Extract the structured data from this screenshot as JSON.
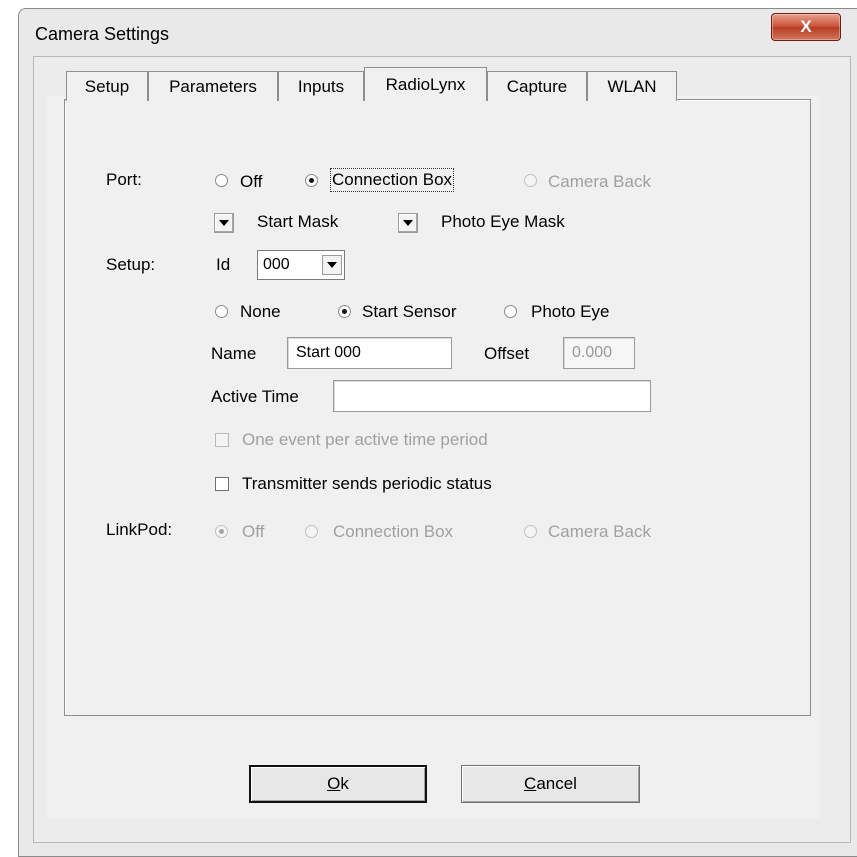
{
  "window": {
    "title": "Camera Settings",
    "close_label": "X"
  },
  "tabs": [
    "Setup",
    "Parameters",
    "Inputs",
    "RadioLynx",
    "Capture",
    "WLAN"
  ],
  "port": {
    "label": "Port:",
    "options": [
      "Off",
      "Connection Box",
      "Camera Back"
    ],
    "selected": "Connection Box"
  },
  "masks": {
    "start_mask": "Start Mask",
    "photo_eye_mask": "Photo Eye Mask"
  },
  "setup": {
    "label": "Setup:",
    "id_label": "Id",
    "id_value": "000",
    "sensor_options": [
      "None",
      "Start Sensor",
      "Photo Eye"
    ],
    "sensor_selected": "Start Sensor",
    "name_label": "Name",
    "name_value": "Start 000",
    "offset_label": "Offset",
    "offset_value": "0.000",
    "active_time_label": "Active Time",
    "active_time_value": "",
    "one_event_label": "One event per active time period",
    "transmitter_label": "Transmitter sends periodic status"
  },
  "linkpod": {
    "label": "LinkPod:",
    "options": [
      "Off",
      "Connection Box",
      "Camera Back"
    ],
    "selected": "Off"
  },
  "buttons": {
    "ok_accel": "O",
    "ok_rest": "k",
    "cancel_accel": "C",
    "cancel_rest": "ancel"
  }
}
